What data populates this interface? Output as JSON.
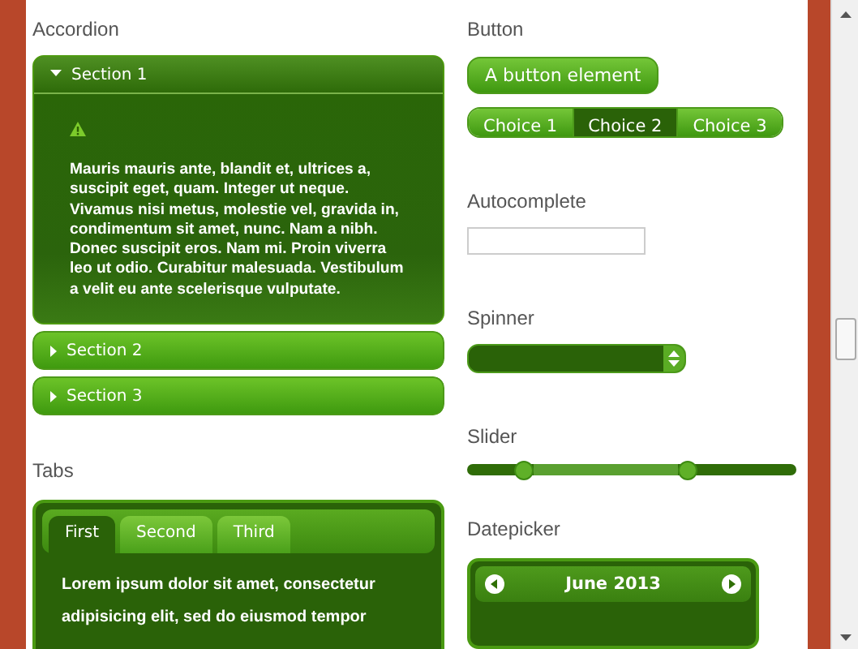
{
  "accordion": {
    "heading": "Accordion",
    "sections": [
      {
        "title": "Section 1",
        "expanded": true,
        "text": "Mauris mauris ante, blandit et, ultrices a, suscipit eget, quam. Integer ut neque. Vivamus nisi metus, molestie vel, gravida in, condimentum sit amet, nunc. Nam a nibh. Donec suscipit eros. Nam mi. Proin viverra leo ut odio. Curabitur malesuada. Vestibulum a velit eu ante scelerisque vulputate."
      },
      {
        "title": "Section 2",
        "expanded": false
      },
      {
        "title": "Section 3",
        "expanded": false
      }
    ]
  },
  "tabs": {
    "heading": "Tabs",
    "items": [
      {
        "label": "First",
        "selected": true
      },
      {
        "label": "Second",
        "selected": false
      },
      {
        "label": "Third",
        "selected": false
      }
    ],
    "text": "Lorem ipsum dolor sit amet, consectetur adipisicing elit, sed do eiusmod tempor"
  },
  "button": {
    "heading": "Button",
    "label": "A button element",
    "choices": [
      {
        "label": "Choice 1",
        "selected": false
      },
      {
        "label": "Choice 2",
        "selected": true
      },
      {
        "label": "Choice 3",
        "selected": false
      }
    ]
  },
  "autocomplete": {
    "heading": "Autocomplete"
  },
  "spinner": {
    "heading": "Spinner"
  },
  "slider": {
    "heading": "Slider",
    "handles": [
      {
        "level": 0.17
      },
      {
        "level": 0.67
      }
    ]
  },
  "datepicker": {
    "heading": "Datepicker",
    "month": "June 2013"
  }
}
